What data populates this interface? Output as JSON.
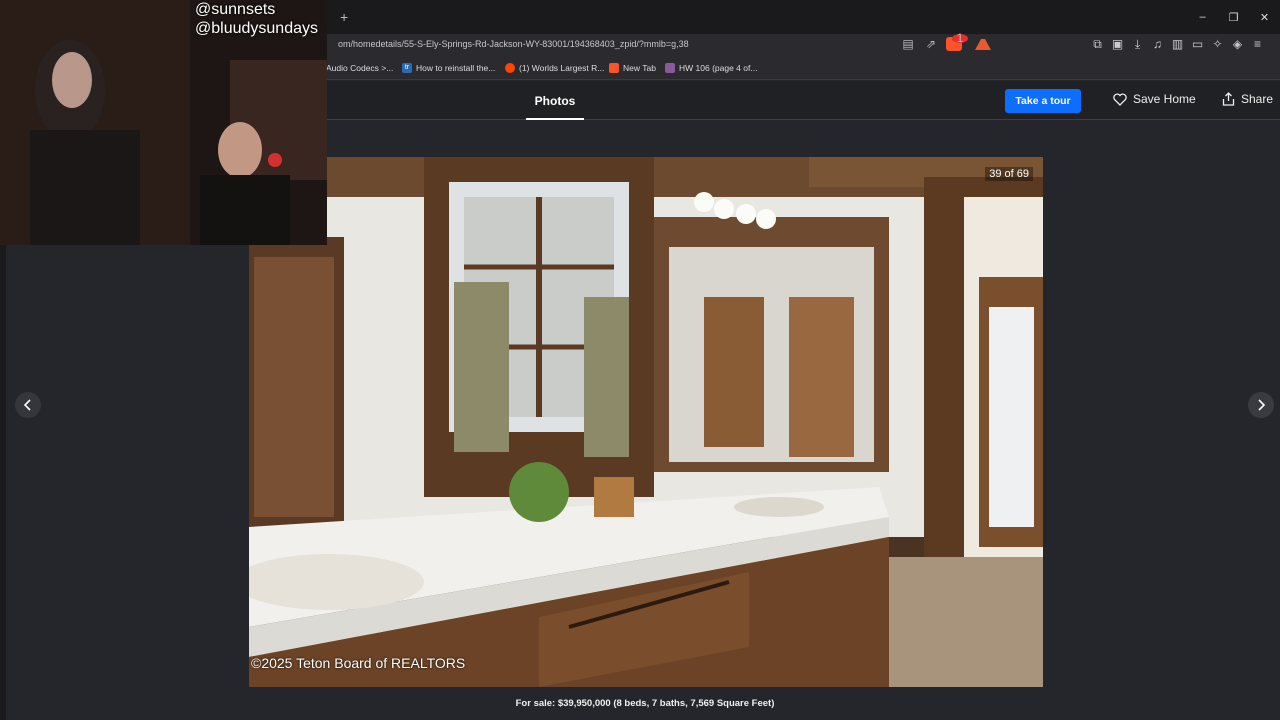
{
  "browser": {
    "new_tab_symbol": "+",
    "window_controls": [
      "–",
      "❐",
      "✕"
    ],
    "url": "om/homedetails/55-S-Ely-Springs-Rd-Jackson-WY-83001/194368403_zpid/?mmlb=g,38",
    "shield_badge": "1",
    "bookmarks": [
      {
        "label": "Audio Codecs >...",
        "icon": "",
        "color": "#2a2a2f"
      },
      {
        "label": "How to reinstall the...",
        "icon": "tr",
        "color": "#2b6cb0"
      },
      {
        "label": "(1) Worlds Largest R...",
        "icon": "r",
        "color": "#ff4500"
      },
      {
        "label": "New Tab",
        "icon": "b",
        "color": "#fb542b"
      },
      {
        "label": "HW 106 (page 4 of...",
        "icon": "",
        "color": "#8a5a9a"
      }
    ]
  },
  "header": {
    "tab_photos": "Photos",
    "take_tour": "Take a tour",
    "save_home": "Save Home",
    "share": "Share"
  },
  "gallery": {
    "counter": "39 of 69",
    "copyright": "©2025 Teton Board of REALTORS",
    "caption": "For sale: $39,950,000 (8 beds, 7 baths, 7,569 Square Feet)"
  },
  "overlay": {
    "line1": "@sunnsets",
    "line2": "@bluudysundays"
  }
}
